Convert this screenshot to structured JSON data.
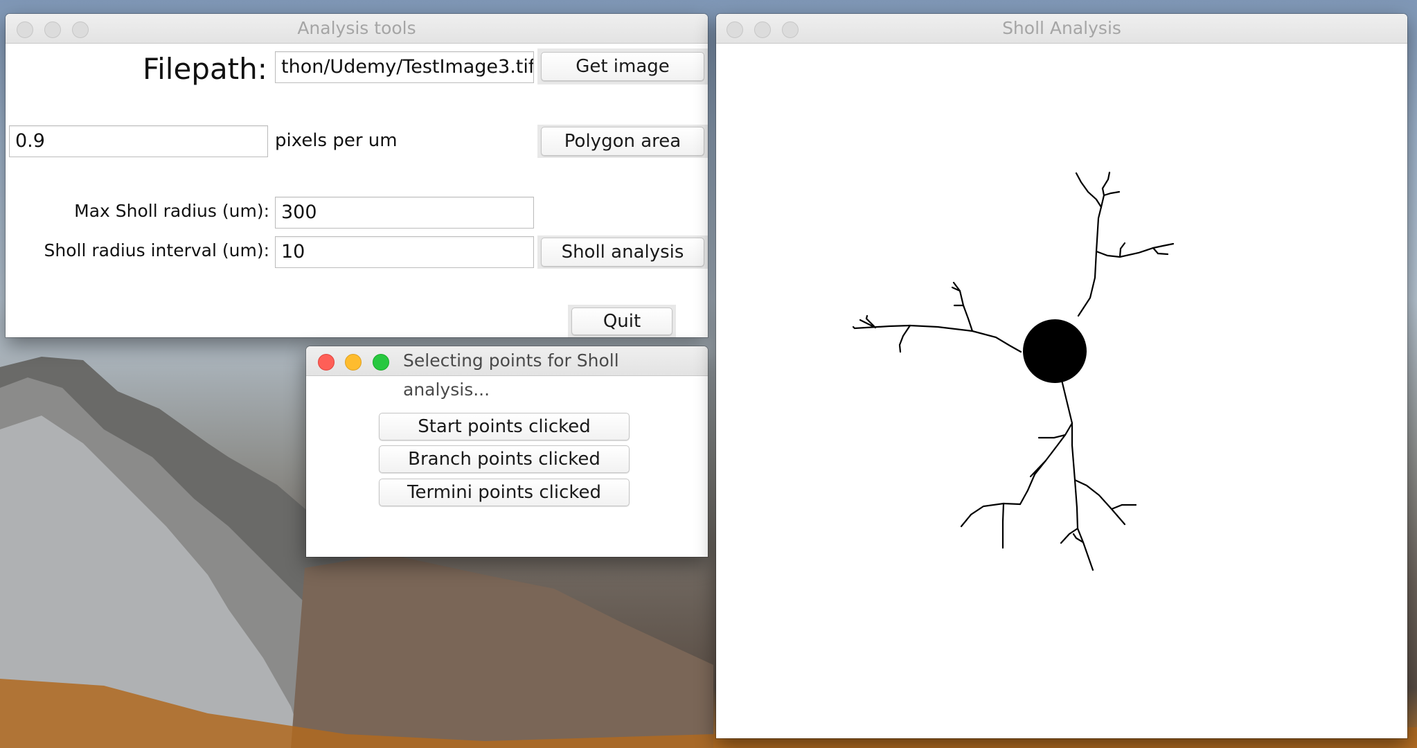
{
  "analysis_window": {
    "title": "Analysis tools",
    "filepath_label": "Filepath:",
    "filepath_value": "thon/Udemy/TestImage3.tif",
    "get_image_label": "Get image",
    "scale_value": "0.9",
    "scale_unit_label": "pixels per um",
    "polygon_area_label": "Polygon area",
    "max_radius_label": "Max Sholl radius (um):",
    "max_radius_value": "300",
    "radius_interval_label": "Sholl radius interval (um):",
    "radius_interval_value": "10",
    "sholl_analysis_label": "Sholl analysis",
    "quit_label": "Quit"
  },
  "selection_dialog": {
    "title": "Selecting points for Sholl analysis...",
    "buttons": [
      "Start points clicked",
      "Branch points clicked",
      "Termini points clicked"
    ]
  },
  "sholl_window": {
    "title": "Sholl Analysis"
  },
  "colors": {
    "close": "#fe5f57",
    "minimize": "#febc2e",
    "zoom": "#28c840",
    "inactive_light": "#dcdcdc",
    "neuron": "#000000"
  },
  "icons": [
    "close-icon",
    "minimize-icon",
    "zoom-icon"
  ]
}
